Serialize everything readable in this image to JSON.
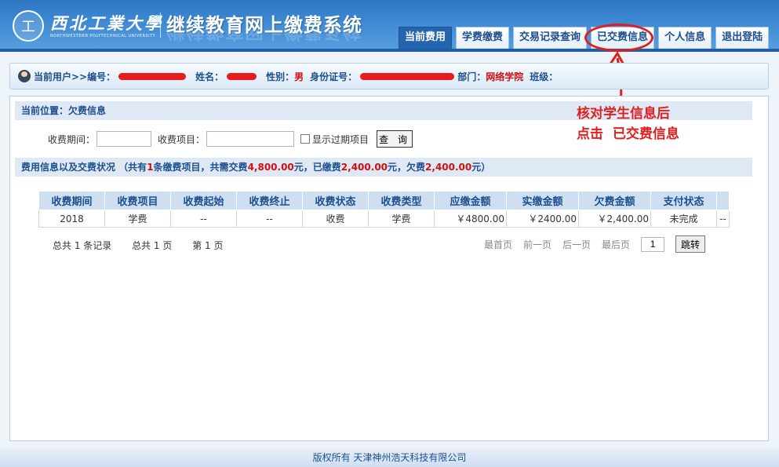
{
  "header": {
    "logo_seal": "工",
    "uni_name": "西北工業大學",
    "uni_name_en": "NORTHWESTERN POLYTECHNICAL UNIVERSITY",
    "system_title": "继续教育网上缴费系统"
  },
  "nav": {
    "tabs": [
      {
        "label": "当前费用",
        "active": true
      },
      {
        "label": "学费缴费",
        "active": false
      },
      {
        "label": "交易记录查询",
        "active": false
      },
      {
        "label": "已交费信息",
        "active": false
      },
      {
        "label": "个人信息",
        "active": false
      },
      {
        "label": "退出登陆",
        "active": false
      }
    ]
  },
  "userbar": {
    "current_user_label": "当前用户>>编号：",
    "name_label": "姓名：",
    "gender_label": "性别：",
    "gender_value": "男",
    "id_label": "身份证号：",
    "dept_label": "部门：",
    "dept_value": "网络学院",
    "class_label": "班级："
  },
  "location": {
    "text": "当前位置：欠费信息"
  },
  "filters": {
    "period_label": "收费期间：",
    "item_label": "收费项目：",
    "show_expired_label": "显示过期项目",
    "query_button": "查 询"
  },
  "summary": {
    "prefix": "费用信息以及交费状况 （共有",
    "count": "1",
    "mid1": "条缴费项目，共需交费",
    "total": "4,800.00",
    "mid2": "元，已缴费",
    "paid": "2,400.00",
    "mid3": "元，欠费",
    "owed": "2,400.00",
    "suffix": "元）"
  },
  "table": {
    "headers": [
      "收费期间",
      "收费项目",
      "收费起始",
      "收费终止",
      "收费状态",
      "收费类型",
      "应缴金额",
      "实缴金额",
      "欠费金额",
      "支付状态",
      ""
    ],
    "rows": [
      [
        "2018",
        "学费",
        "--",
        "--",
        "收费",
        "学费",
        "￥4800.00",
        "￥2400.00",
        "￥2,400.00",
        "未完成",
        "--"
      ]
    ]
  },
  "pager": {
    "total_records": "总共 1 条记录",
    "total_pages": "总共 1 页",
    "current_page": "第 1 页",
    "first": "最首页",
    "prev": "前一页",
    "next": "后一页",
    "last": "最后页",
    "page_input_value": "1",
    "jump_button": "跳转"
  },
  "annotation": {
    "line1": "核对学生信息后",
    "line2": "点击  已交费信息"
  },
  "footer": {
    "text": "版权所有 天津神州浩天科技有限公司"
  }
}
